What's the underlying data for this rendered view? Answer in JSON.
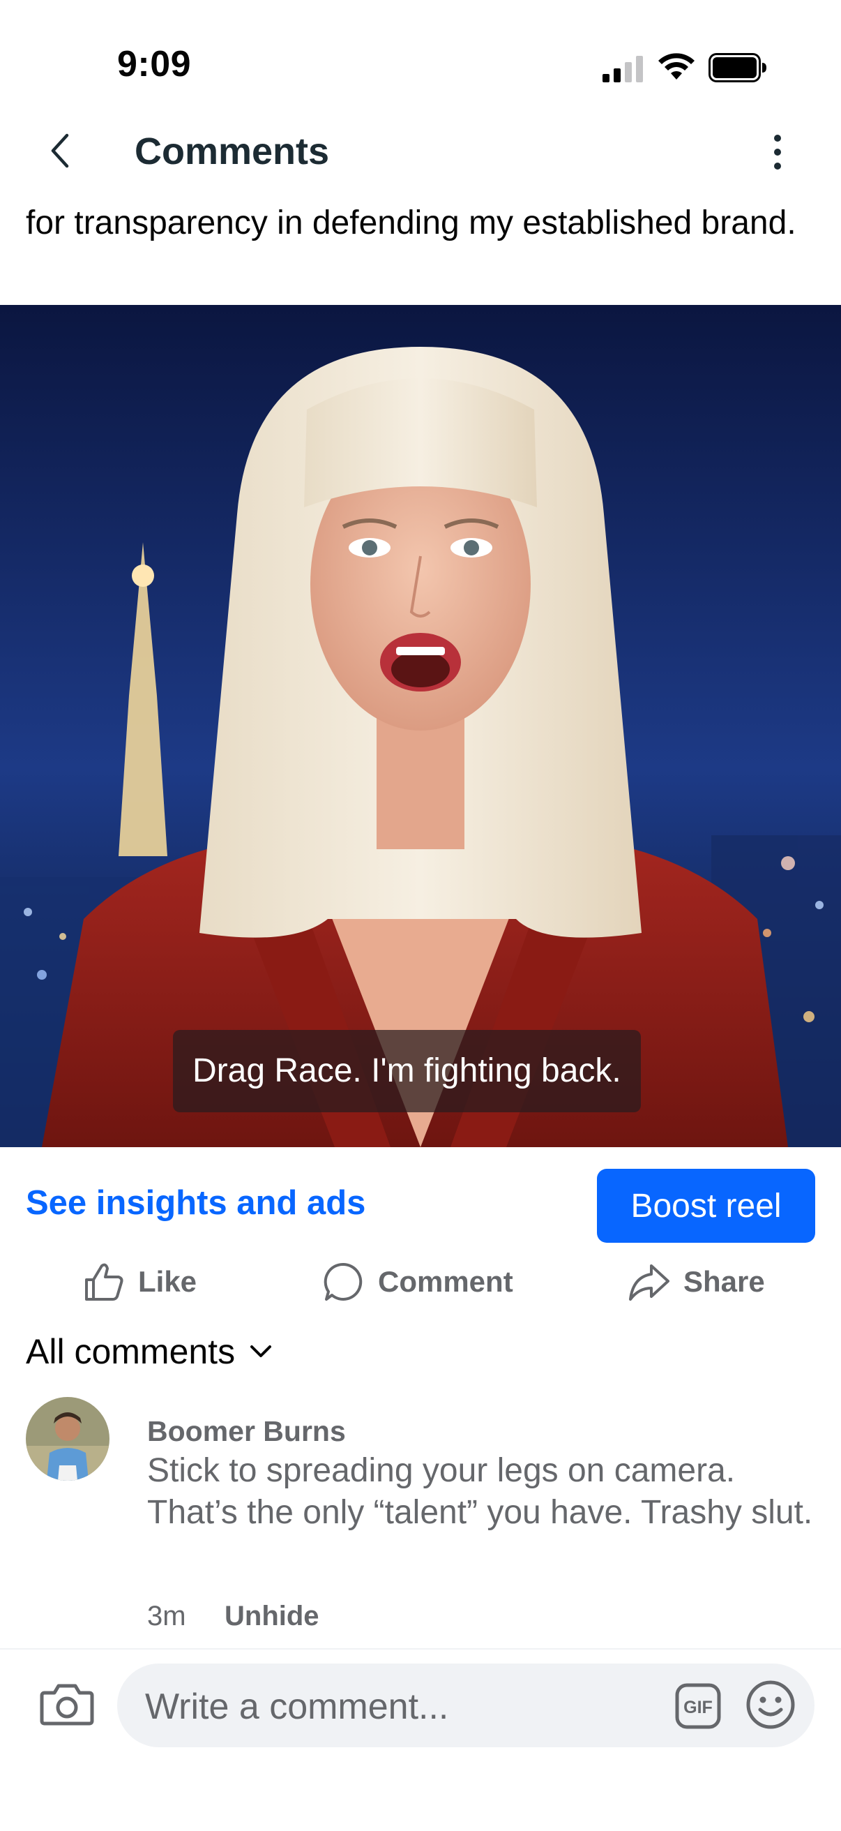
{
  "status_bar": {
    "time": "9:09"
  },
  "header": {
    "title": "Comments"
  },
  "post": {
    "caption": "for transparency in defending my established brand.",
    "subtitle": "Drag Race. I'm fighting back."
  },
  "actions": {
    "insights_label": "See insights and ads",
    "boost_label": "Boost reel",
    "like_label": "Like",
    "comment_label": "Comment",
    "share_label": "Share"
  },
  "comments_filter": {
    "label": "All comments"
  },
  "comments": [
    {
      "author": "Boomer Burns",
      "text": "Stick to spreading your legs on camera. That’s the only “talent” you have. Trashy slut.",
      "time": "3m",
      "action": "Unhide"
    }
  ],
  "composer": {
    "placeholder": "Write a comment..."
  },
  "colors": {
    "accent": "#0866ff",
    "muted": "#65676b",
    "input_bg": "#f0f2f5"
  },
  "icons": [
    "signal-icon",
    "wifi-icon",
    "battery-icon",
    "back-icon",
    "more-icon",
    "like-icon",
    "comment-icon",
    "share-icon",
    "chevron-down-icon",
    "camera-icon",
    "gif-icon",
    "emoji-icon"
  ]
}
